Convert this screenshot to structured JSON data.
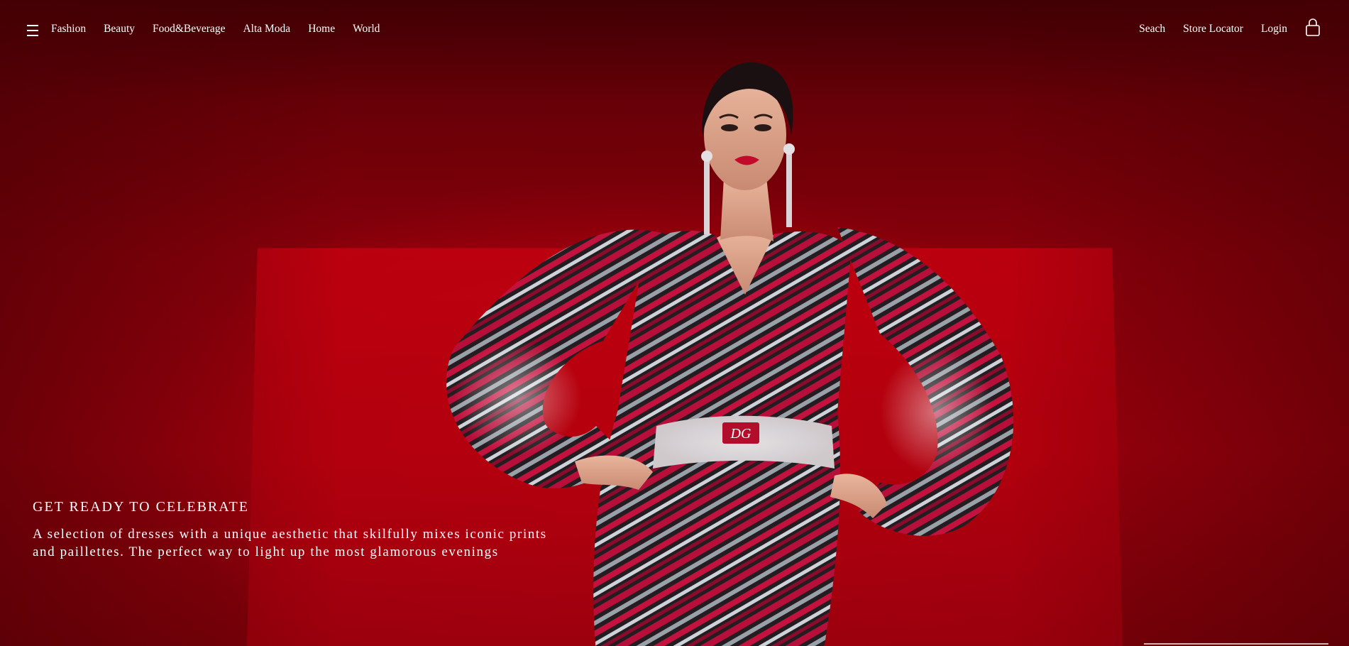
{
  "header": {
    "menu_icon": "hamburger-menu-icon",
    "nav_items": [
      "Fashion",
      "Beauty",
      "Food&Beverage",
      "Alta Moda",
      "Home",
      "World"
    ],
    "utility_items": [
      "Seach",
      "Store Locator",
      "Login"
    ],
    "bag_icon": "shopping-bag-icon"
  },
  "hero": {
    "title": "GET READY TO CELEBRATE",
    "description_line1": "A selection of dresses with a unique aesthetic that skilfully mixes iconic prints",
    "description_line2": "and paillettes. The perfect way to light up the most glamorous evenings",
    "image": "model-in-sequin-zebra-print-dress",
    "belt_logo_text": "DG",
    "background_color": "#a8000c"
  }
}
